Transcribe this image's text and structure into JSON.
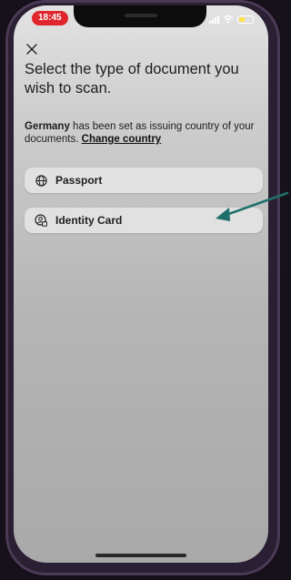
{
  "status_bar": {
    "time": "18:45"
  },
  "screen": {
    "title": "Select the type of document you wish to scan.",
    "info": {
      "country": "Germany",
      "text": " has been set as issuing country of your documents. ",
      "change_link": "Change country"
    },
    "options": [
      {
        "label": "Passport",
        "icon": "globe-icon"
      },
      {
        "label": "Identity Card",
        "icon": "id-card-icon"
      }
    ]
  },
  "colors": {
    "time_pill": "#e0262c",
    "option_bg": "#e2e1e2",
    "annotation_arrow": "#1f6f6a",
    "battery": "#ffe24a"
  }
}
